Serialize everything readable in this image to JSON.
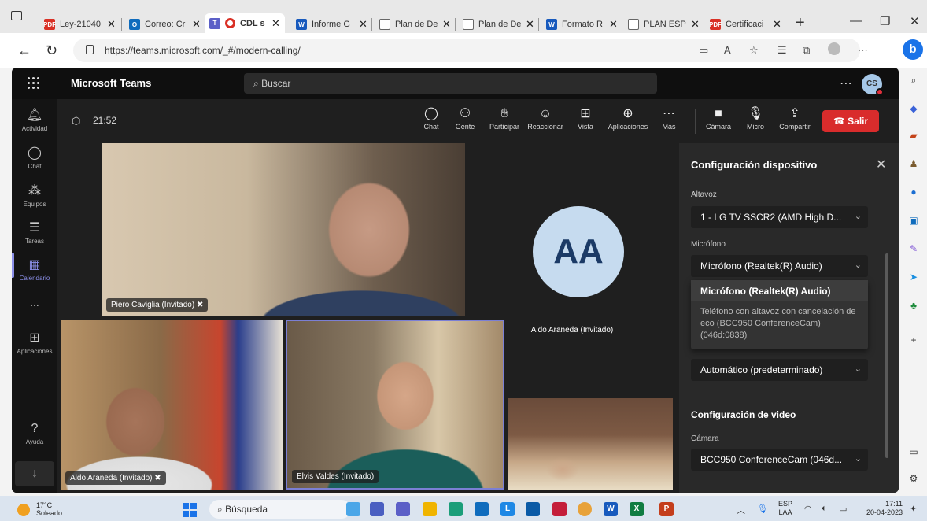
{
  "browser": {
    "tabs": [
      {
        "title": "Ley-21040",
        "fav_color": "#d93025",
        "fav_glyph": "PDF"
      },
      {
        "title": "Correo: Cr",
        "fav_color": "#0f6cbd",
        "fav_glyph": "O"
      },
      {
        "title": "CDL s",
        "fav_color": "#5b5fc7",
        "fav_glyph": "T",
        "active": true
      },
      {
        "title": "Informe G",
        "fav_color": "#185abd",
        "fav_glyph": "W"
      },
      {
        "title": "Plan de De",
        "fav_color": "#ffffff",
        "fav_glyph": ""
      },
      {
        "title": "Plan de De",
        "fav_color": "#ffffff",
        "fav_glyph": ""
      },
      {
        "title": "Formato R",
        "fav_color": "#185abd",
        "fav_glyph": "W"
      },
      {
        "title": "PLAN ESPE",
        "fav_color": "#ffffff",
        "fav_glyph": ""
      },
      {
        "title": "Certificaci",
        "fav_color": "#d93025",
        "fav_glyph": "PDF"
      }
    ],
    "url": "https://teams.microsoft.com/_#/modern-calling/"
  },
  "teams": {
    "brand": "Microsoft Teams",
    "search_placeholder": "Buscar",
    "user_initials": "CS",
    "rail": [
      {
        "label": "Actividad",
        "icon": "bell-icon"
      },
      {
        "label": "Chat",
        "icon": "chat-icon"
      },
      {
        "label": "Equipos",
        "icon": "teams-icon"
      },
      {
        "label": "Tareas",
        "icon": "tasks-icon"
      },
      {
        "label": "Calendario",
        "icon": "calendar-icon",
        "active": true
      },
      {
        "label": "...",
        "icon": "more-icon"
      },
      {
        "label": "Aplicaciones",
        "icon": "apps-icon"
      },
      {
        "label": "Ayuda",
        "icon": "help-icon"
      }
    ],
    "call": {
      "timer": "21:52",
      "toolbar": [
        {
          "label": "Chat",
          "icon": "chat-icon"
        },
        {
          "label": "Gente",
          "icon": "people-icon"
        },
        {
          "label": "Participar",
          "icon": "raise-hand-icon"
        },
        {
          "label": "Reaccionar",
          "icon": "smiley-icon"
        },
        {
          "label": "Vista",
          "icon": "grid-view-icon"
        },
        {
          "label": "Aplicaciones",
          "icon": "add-apps-icon"
        },
        {
          "label": "Más",
          "icon": "more-icon"
        },
        {
          "label": "Cámara",
          "icon": "camera-icon"
        },
        {
          "label": "Micro",
          "icon": "mic-icon"
        },
        {
          "label": "Compartir",
          "icon": "share-icon"
        }
      ],
      "leave_label": "Salir"
    },
    "participants": {
      "piero": "Piero Caviglia (Invitado)",
      "aa_initials": "AA",
      "aa_name": "Aldo Araneda (Invitado)",
      "aldo": "Aldo Araneda (Invitado)",
      "elvis": "Elvis Valdes (Invitado)"
    },
    "panel": {
      "title": "Configuración dispositivo",
      "speaker_label": "Altavoz",
      "speaker_value": "1 - LG TV SSCR2 (AMD High D...",
      "mic_label": "Micrófono",
      "mic_value": "Micrófono (Realtek(R) Audio)",
      "options": [
        "Micrófono (Realtek(R) Audio)",
        "Teléfono con altavoz con cancelación de eco (BCC950 ConferenceCam) (046d:0838)"
      ],
      "noise_value": "Automático (predeterminado)",
      "video_section": "Configuración de video",
      "camera_label": "Cámara",
      "camera_value": "BCC950 ConferenceCam (046d..."
    }
  },
  "taskbar": {
    "temp": "17°C",
    "weather": "Soleado",
    "search": "Búsqueda",
    "lang": "ESP",
    "lang2": "LAA",
    "time": "17:11",
    "date": "20-04-2023"
  }
}
